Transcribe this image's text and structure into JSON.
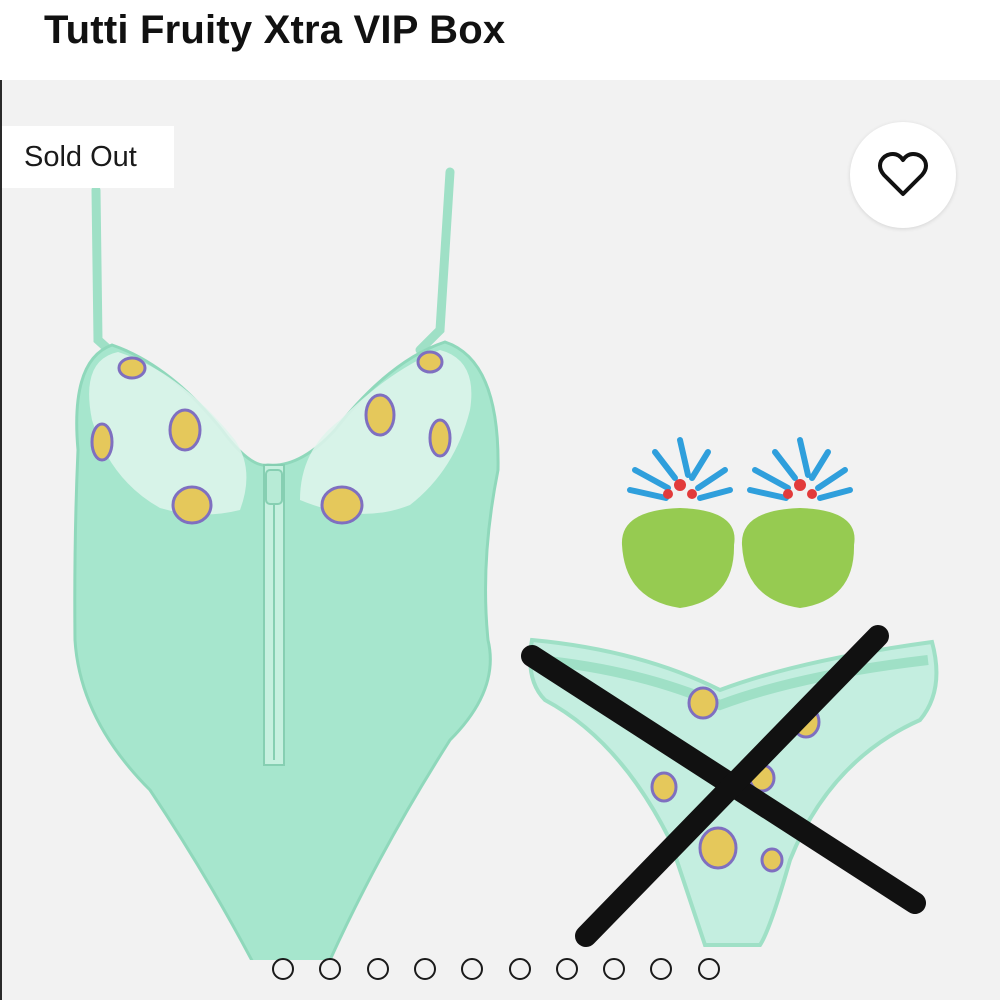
{
  "product": {
    "title": "Tutti Fruity Xtra VIP Box",
    "status_badge": "Sold Out"
  },
  "favorite": {
    "icon": "heart-outline-icon"
  },
  "gallery": {
    "dot_count": 10,
    "dots": [
      "1",
      "2",
      "3",
      "4",
      "5",
      "6",
      "7",
      "8",
      "9",
      "10"
    ],
    "images": [
      {
        "name": "bodysuit",
        "color": "#a6e6cd"
      },
      {
        "name": "pasties",
        "colors": [
          "#2f9fdc",
          "#e23b3b",
          "#8cc63f"
        ]
      },
      {
        "name": "panty",
        "crossed_out": true
      }
    ]
  },
  "colors": {
    "background": "#f2f2f2",
    "garment": "#a6e6cd",
    "cross_mark": "#111111"
  }
}
